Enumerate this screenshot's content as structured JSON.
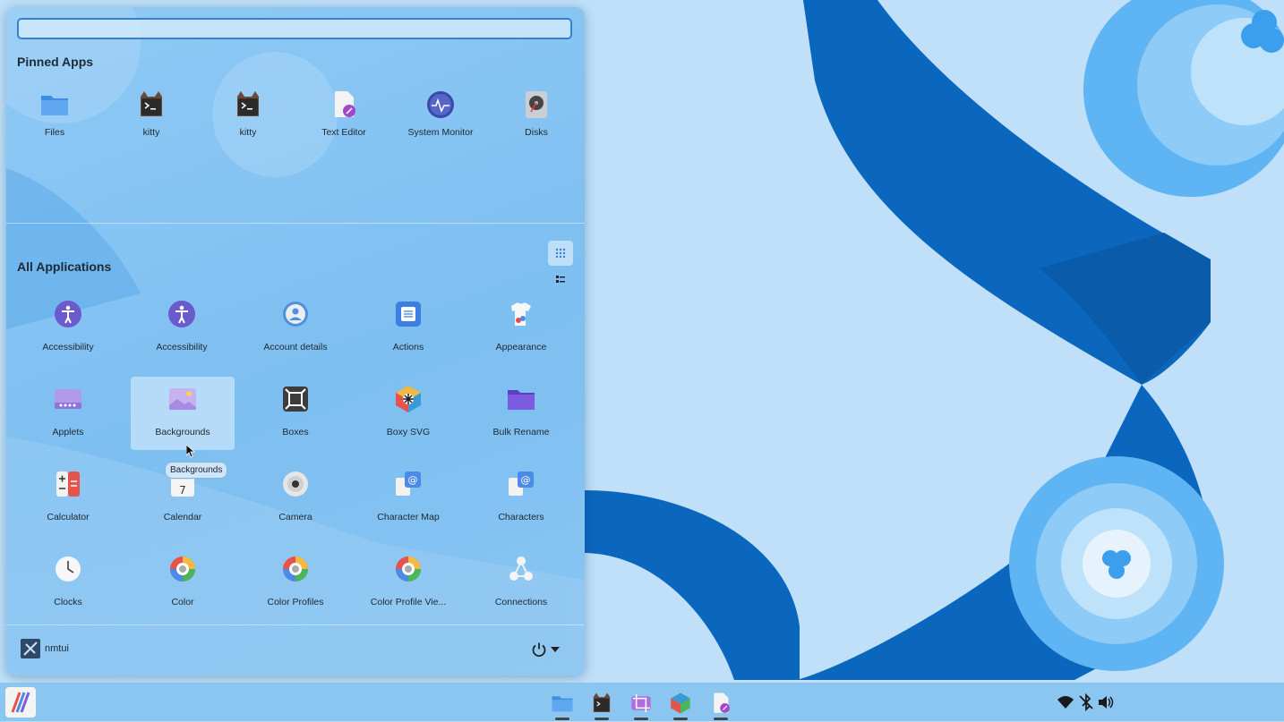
{
  "search": {
    "value": "",
    "placeholder": ""
  },
  "pinned": {
    "title": "Pinned Apps",
    "items": [
      {
        "label": "Files",
        "icon": "folder-icon"
      },
      {
        "label": "kitty",
        "icon": "kitty-terminal-icon"
      },
      {
        "label": "kitty",
        "icon": "kitty-terminal-icon"
      },
      {
        "label": "Text Editor",
        "icon": "text-editor-icon"
      },
      {
        "label": "System Monitor",
        "icon": "system-monitor-icon"
      },
      {
        "label": "Disks",
        "icon": "disks-icon"
      }
    ]
  },
  "all_apps": {
    "title": "All Applications",
    "items": [
      {
        "label": "Accessibility",
        "icon": "accessibility-icon"
      },
      {
        "label": "Accessibility",
        "icon": "accessibility-icon"
      },
      {
        "label": "Account details",
        "icon": "account-icon"
      },
      {
        "label": "Actions",
        "icon": "actions-icon"
      },
      {
        "label": "Appearance",
        "icon": "appearance-icon"
      },
      {
        "label": "Applets",
        "icon": "applets-icon"
      },
      {
        "label": "Backgrounds",
        "icon": "backgrounds-icon"
      },
      {
        "label": "Boxes",
        "icon": "boxes-icon"
      },
      {
        "label": "Boxy SVG",
        "icon": "boxy-svg-icon"
      },
      {
        "label": "Bulk Rename",
        "icon": "bulk-rename-icon"
      },
      {
        "label": "Calculator",
        "icon": "calculator-icon"
      },
      {
        "label": "Calendar",
        "icon": "calendar-icon"
      },
      {
        "label": "Camera",
        "icon": "camera-icon"
      },
      {
        "label": "Character Map",
        "icon": "character-map-icon"
      },
      {
        "label": "Characters",
        "icon": "characters-icon"
      },
      {
        "label": "Clocks",
        "icon": "clock-icon"
      },
      {
        "label": "Color",
        "icon": "color-icon"
      },
      {
        "label": "Color Profiles",
        "icon": "color-icon"
      },
      {
        "label": "Color Profile Vie...",
        "icon": "color-icon"
      },
      {
        "label": "Connections",
        "icon": "connections-icon"
      }
    ]
  },
  "tooltip": "Backgrounds",
  "footer": {
    "user": "nmtui",
    "user_icon": "nmtui-icon",
    "power_icon": "power-icon"
  },
  "taskbar": {
    "start_icon": "app-launcher-icon",
    "items": [
      "files-icon",
      "kitty-terminal-icon",
      "screenshot-icon",
      "package-icon",
      "text-editor-icon"
    ],
    "tray": [
      "wifi-icon",
      "bluetooth-off-icon",
      "volume-icon"
    ]
  },
  "colors": {
    "accent": "#3a80c9",
    "wallpaper_ribbon": "#0a62b8"
  }
}
